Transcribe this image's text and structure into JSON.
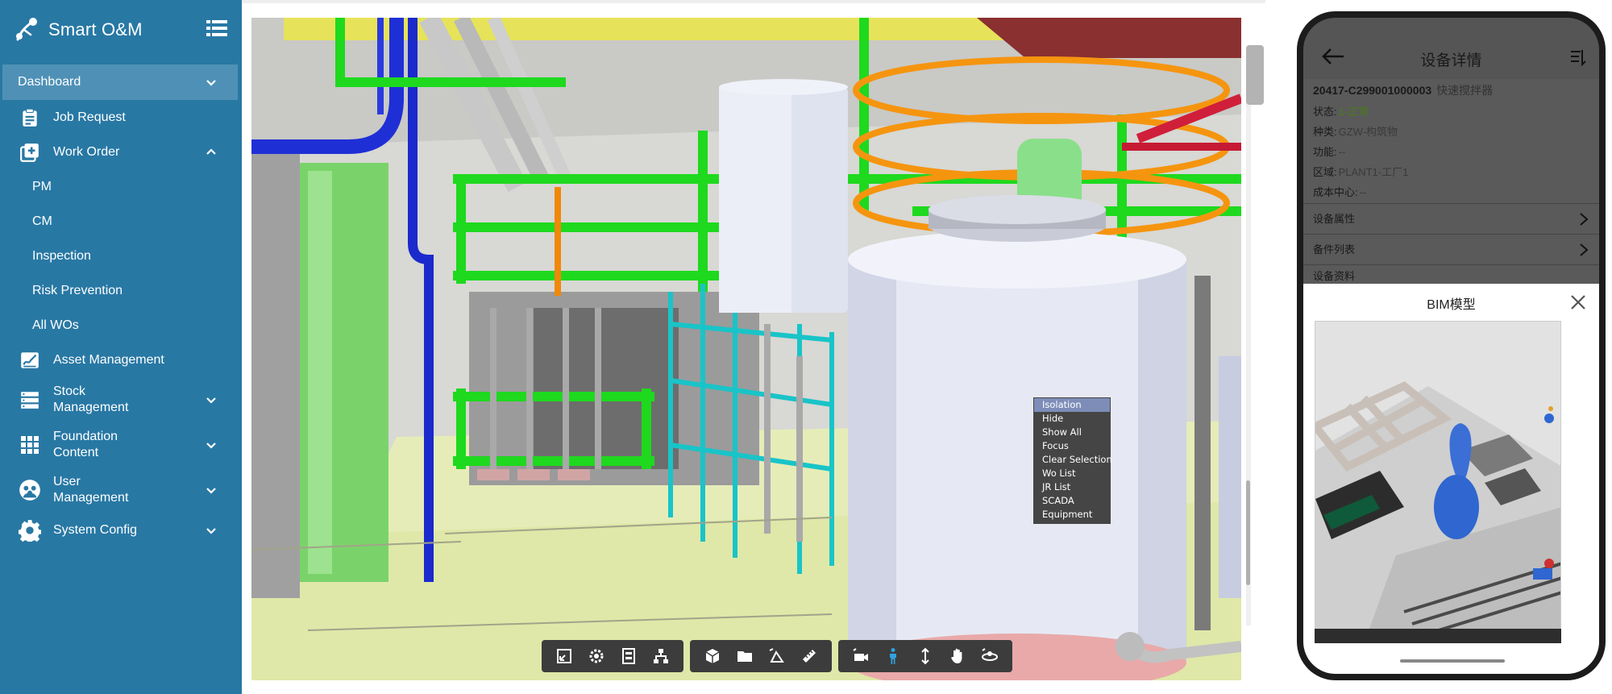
{
  "app": {
    "title": "Smart O&M"
  },
  "sidebar": {
    "items": [
      {
        "label": "Dashboard",
        "icon": "chevron-down-icon"
      },
      {
        "label": "Job Request",
        "icon": "clipboard-icon"
      },
      {
        "label": "Work Order",
        "icon": "add-box-icon"
      },
      {
        "label": "PM"
      },
      {
        "label": "CM"
      },
      {
        "label": "Inspection"
      },
      {
        "label": "Risk Prevention"
      },
      {
        "label": "All WOs"
      },
      {
        "label": "Asset Management",
        "icon": "contract-icon"
      },
      {
        "label": "Stock Management",
        "icon": "storage-icon"
      },
      {
        "label": "Foundation Content",
        "icon": "grid-icon"
      },
      {
        "label": "User Management",
        "icon": "users-icon"
      },
      {
        "label": "System Config",
        "icon": "gear-icon"
      }
    ]
  },
  "context_menu": {
    "items": [
      "Isolation",
      "Hide",
      "Show All",
      "Focus",
      "Clear Selection",
      "Wo List",
      "JR List",
      "SCADA",
      "Equipment"
    ],
    "selected": "Isolation"
  },
  "toolbar": {
    "groups": [
      [
        "fit-view-icon",
        "settings-icon",
        "properties-icon",
        "model-tree-icon"
      ],
      [
        "cube-icon",
        "folder-icon",
        "section-icon",
        "measure-icon"
      ],
      [
        "camera-icon",
        "walk-person-icon",
        "vertical-move-icon",
        "pan-hand-icon",
        "orbit-icon"
      ]
    ]
  },
  "phone": {
    "title": "设备详情",
    "code": "20417-C299001000003",
    "code_name": "快速搅拌器",
    "fields": [
      {
        "label": "状态:",
        "value": "1-正常"
      },
      {
        "label": "种类:",
        "value": "GZW-构筑物"
      },
      {
        "label": "功能:",
        "value": "--"
      },
      {
        "label": "区域:",
        "value": "PLANT1-工厂1"
      },
      {
        "label": "成本中心:",
        "value": "--"
      }
    ],
    "links": [
      "设备属性",
      "备件列表",
      "设备资料"
    ],
    "bim_title": "BIM模型"
  },
  "colors": {
    "sidebar_bg": "#2878a4",
    "sidebar_active": "#4f91b6",
    "ctx_menu_bg": "#454545",
    "ctx_menu_selected": "#7d8db8",
    "status_ok": "#4a7a1a",
    "walk_active": "#2fa3e0"
  }
}
